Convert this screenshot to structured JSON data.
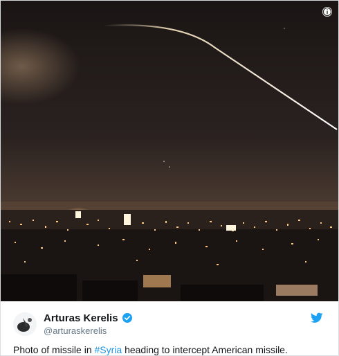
{
  "icons": {
    "info": "info-icon",
    "verified": "verified-badge-icon",
    "twitter": "twitter-bird-icon",
    "avatar": "user-avatar"
  },
  "colors": {
    "link": "#1b95e0",
    "verified": "#1da1f2",
    "text": "#14171a",
    "muted": "#657786"
  },
  "tweet": {
    "author_name": "Arturas Kerelis",
    "author_handle": "@arturaskerelis",
    "text_before": "Photo of missile in ",
    "hashtag": "#Syria",
    "text_after": " heading to intercept American missile."
  }
}
